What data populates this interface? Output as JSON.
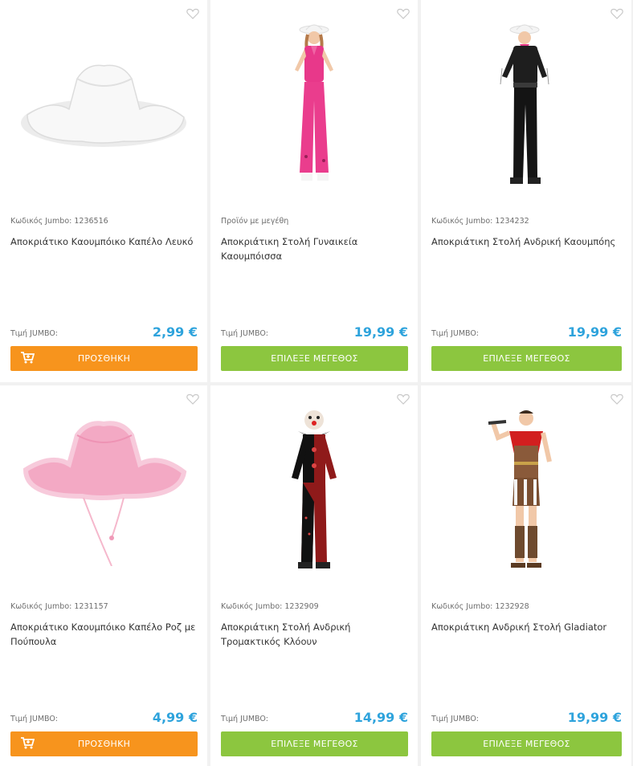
{
  "price_label": "Τιμή JUMBO:",
  "products": [
    {
      "code": "Κωδικός Jumbo: 1236516",
      "name": "Αποκριάτικο Καουμπόικο Καπέλο Λευκό",
      "price": "2,99 €",
      "button": "ΠΡΟΣΘΗΚΗ"
    },
    {
      "code": "Προϊόν με μεγέθη",
      "name": "Αποκριάτικη Στολή Γυναικεία Καουμπόισσα",
      "price": "19,99 €",
      "button": "ΕΠΙΛΕΞΕ ΜΕΓΕΘΟΣ"
    },
    {
      "code": "Κωδικός Jumbo: 1234232",
      "name": "Αποκριάτικη Στολή Ανδρική Καουμπόης",
      "price": "19,99 €",
      "button": "ΕΠΙΛΕΞΕ ΜΕΓΕΘΟΣ"
    },
    {
      "code": "Κωδικός Jumbo: 1231157",
      "name": "Αποκριάτικο Καουμπόικο Καπέλο Ροζ με Πούπουλα",
      "price": "4,99 €",
      "button": "ΠΡΟΣΘΗΚΗ"
    },
    {
      "code": "Κωδικός Jumbo: 1232909",
      "name": "Αποκριάτικη Στολή Ανδρική Τρομακτικός Κλόουν",
      "price": "14,99 €",
      "button": "ΕΠΙΛΕΞΕ ΜΕΓΕΘΟΣ"
    },
    {
      "code": "Κωδικός Jumbo: 1232928",
      "name": "Αποκριάτικη Ανδρική Στολή Gladiator",
      "price": "19,99 €",
      "button": "ΕΠΙΛΕΞΕ ΜΕΓΕΘΟΣ"
    }
  ],
  "colors": {
    "price": "#2ea3dc",
    "add_button": "#f7941d",
    "size_button": "#8cc63f"
  },
  "icons": {
    "wishlist": "heart-outline-icon",
    "cart": "cart-icon"
  }
}
